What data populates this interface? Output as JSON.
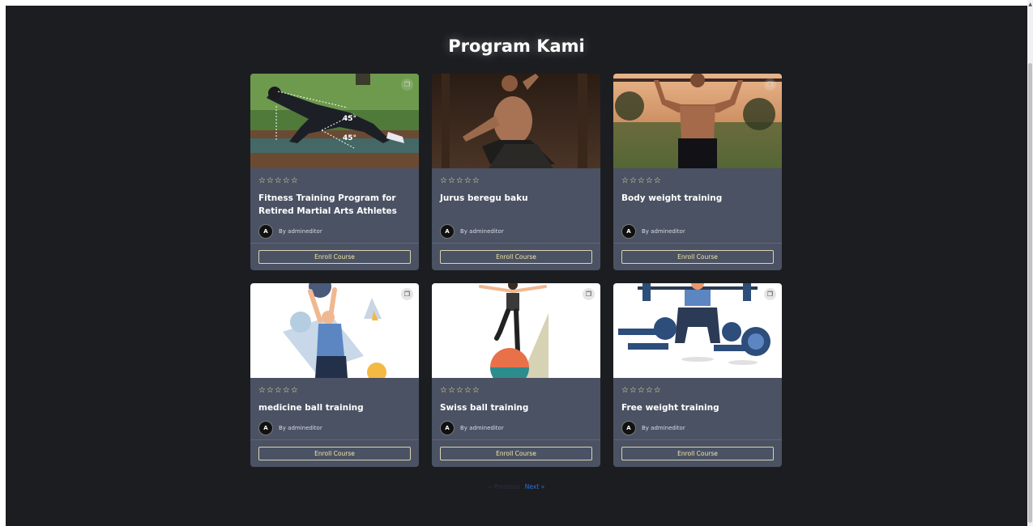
{
  "page": {
    "title": "Program Kami"
  },
  "courses_row1": [
    {
      "title": "Fitness Training Program for Retired Martial Arts Athletes",
      "author": "By admineditor",
      "avatar": "A",
      "stars": "☆☆☆☆☆",
      "cta": "Enroll Course"
    },
    {
      "title": "Jurus beregu baku",
      "author": "By admineditor",
      "avatar": "A",
      "stars": "☆☆☆☆☆",
      "cta": "Enroll Course"
    },
    {
      "title": "Body weight training",
      "author": "By admineditor",
      "avatar": "A",
      "stars": "☆☆☆☆☆",
      "cta": "Enroll Course"
    }
  ],
  "courses_row2": [
    {
      "title": "medicine ball training",
      "author": "By admineditor",
      "avatar": "A",
      "stars": "☆☆☆☆☆",
      "cta": "Enroll Course"
    },
    {
      "title": "Swiss ball training",
      "author": "By admineditor",
      "avatar": "A",
      "stars": "☆☆☆☆☆",
      "cta": "Enroll Course"
    },
    {
      "title": "Free weight training",
      "author": "By admineditor",
      "avatar": "A",
      "stars": "☆☆☆☆☆",
      "cta": "Enroll Course"
    }
  ],
  "image_labels": {
    "angle_top": "45°",
    "angle_bottom": "45°"
  },
  "pagination": {
    "prev": "« Previous",
    "next": "Next »"
  },
  "colors": {
    "background": "#1c1d21",
    "card": "#4a5263",
    "accent": "#f5e6a8",
    "link": "#2f6fd6"
  },
  "icons": {
    "bookmark": "bookmark-icon",
    "star": "star-outline-icon"
  }
}
